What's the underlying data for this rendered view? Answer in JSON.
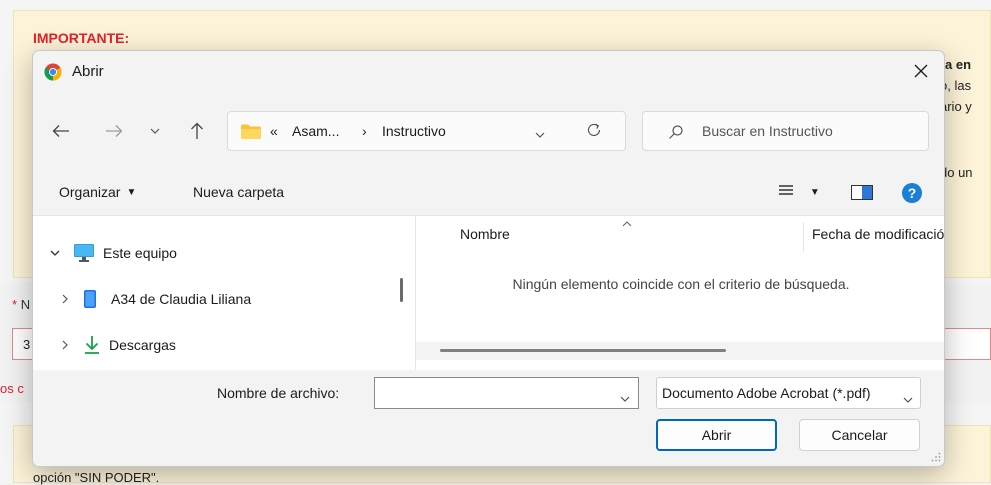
{
  "background": {
    "important_label": "IMPORTANTE:",
    "right_lines": [
      "ra en",
      "o, las",
      "ario y",
      "do un"
    ],
    "required_star": "*",
    "required_label": "N",
    "input_value": "3",
    "error_text": "os c",
    "bottom_text": "opción \"SIN PODER\"."
  },
  "dialog": {
    "title": "Abrir",
    "icons": {
      "app": "chrome-icon",
      "close": "close-icon",
      "back": "arrow-left-icon",
      "forward": "arrow-right-icon",
      "recent": "chevron-down-icon",
      "up": "arrow-up-icon",
      "refresh": "refresh-icon",
      "search": "search-icon",
      "view": "list-view-icon",
      "preview": "preview-pane-icon",
      "help": "help-icon"
    },
    "address": {
      "overflow": "«",
      "crumb1": "Asam...",
      "separator": "›",
      "crumb2": "Instructivo"
    },
    "search": {
      "placeholder": "Buscar en Instructivo"
    },
    "toolbar": {
      "organize": "Organizar",
      "new_folder": "Nueva carpeta",
      "help": "?"
    },
    "nav_tree": [
      {
        "label": "Este equipo",
        "icon": "computer-icon",
        "expanded": true
      },
      {
        "label": "A34 de Claudia Liliana",
        "icon": "phone-icon",
        "expanded": false
      },
      {
        "label": "Descargas",
        "icon": "download-icon",
        "expanded": false
      }
    ],
    "columns": {
      "name": "Nombre",
      "date": "Fecha de modificación"
    },
    "empty_message": "Ningún elemento coincide con el criterio de búsqueda.",
    "filename": {
      "label": "Nombre de archivo:",
      "value": ""
    },
    "filetype": {
      "selected": "Documento Adobe Acrobat (*.pdf)"
    },
    "buttons": {
      "open": "Abrir",
      "cancel": "Cancelar"
    },
    "colors": {
      "accent": "#0067c0",
      "folder": "#f8c33a",
      "computer": "#2f9fe0",
      "download": "#16a34a",
      "phone": "#1f6feb",
      "important": "#e4202b"
    }
  }
}
